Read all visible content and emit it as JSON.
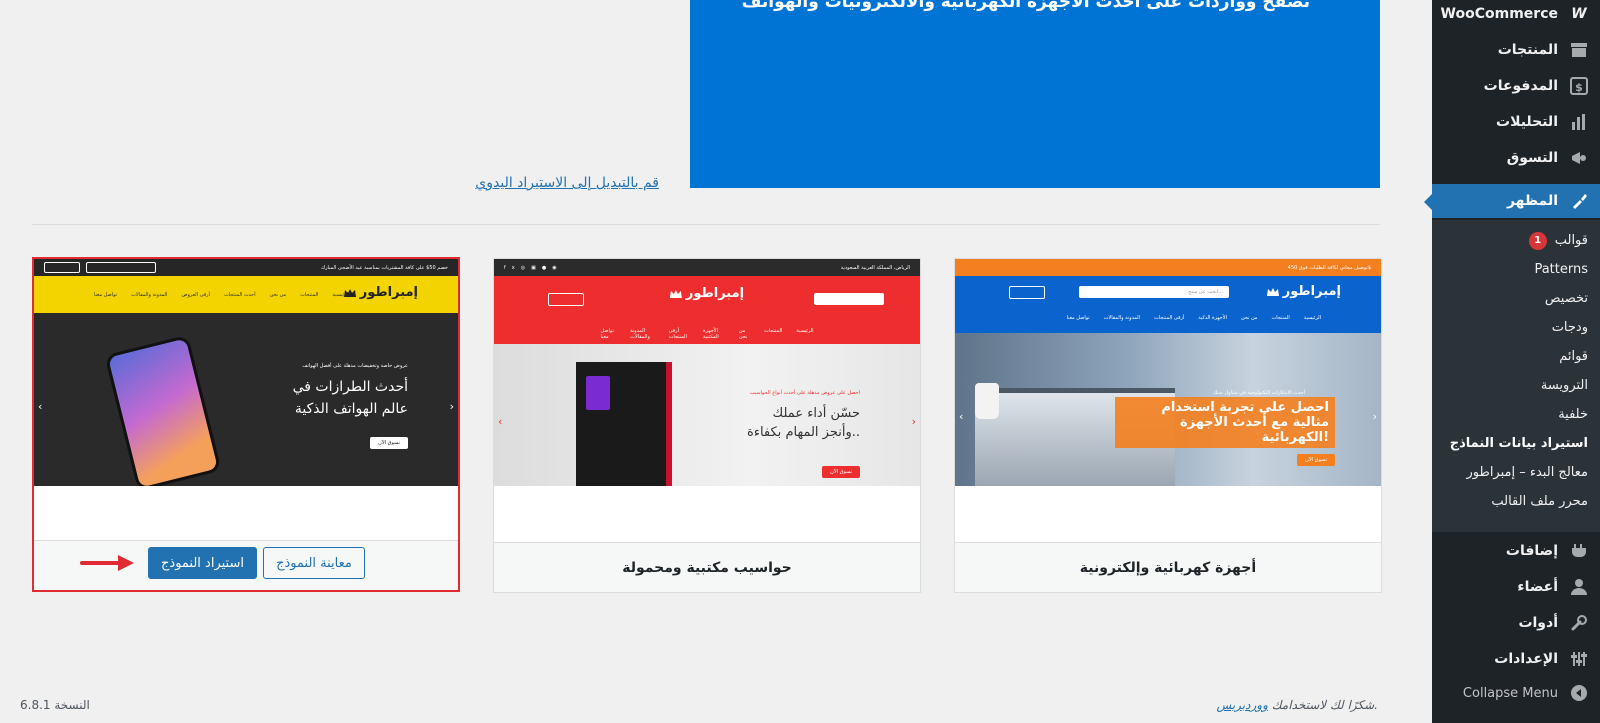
{
  "banner": {
    "text": "تصفح وواردات على أحدث الأجهزة الكهربائية والالكترونيات والهواتف"
  },
  "manual_link": "قم بالتبديل إلى الاستيراد اليدوي",
  "cards": [
    {
      "name": "أجهزة كهربائية وإلكترونية",
      "top_text": "توصيل مجاني لكافة الطلبات فوق 450$",
      "logo": "إمبراطور",
      "search_placeholder": "ابحث عن منتج...",
      "nav": [
        "الرئيسية",
        "المنتجات",
        "من نحن",
        "الأجهزة الذكية",
        "أرقى المنتجات",
        "المدونة والمقالات",
        "تواصل معنا"
      ],
      "eyebrow": "أحدث الابتكارات التكنولوجية في متناول يديك",
      "headline1": "احصل على تجربة استخدام",
      "headline2": "مثالية مع أحدث الأجهزة الكهربائية!",
      "cta": "تسوق الآن"
    },
    {
      "name": "حواسيب مكتبية ومحمولة",
      "top_text": "الرياض، المملكة العربية السعودية",
      "logo": "إمبراطور",
      "nav": [
        "الرئيسية",
        "المنتجات",
        "من نحن",
        "الأجهزة المكتبية",
        "أرقى المنتجات",
        "المدونة والمقالات",
        "تواصل معنا"
      ],
      "eyebrow": "احصل على عروض مذهلة على أحدث أنواع الحواسيب",
      "headline1": "حسّن أداء عملك",
      "headline2": "وأنجز المهام بكفاءة..",
      "cta": "تسوق الآن"
    },
    {
      "name": "",
      "top_text": "خصم 50$ على كافة المشتريات بمناسبة عيد الأضحى المبارك",
      "logo": "إمبراطور",
      "nav": [
        "الرئيسية",
        "المنتجات",
        "من نحن",
        "أحدث المنتجات",
        "أرقى العروض",
        "المدونة والمقالات",
        "تواصل معنا"
      ],
      "eyebrow": "عروض خاصة وتخفيضات مذهلة على أفضل الهواتف",
      "headline1": "أحدث الطرازات في",
      "headline2": "عالم الهواتف الذكية",
      "cta": "تسوق الآن",
      "import_button": "استيراد النموذج",
      "preview_button": "معاينة النموذج"
    }
  ],
  "sidebar": {
    "items": [
      {
        "label": "WooCommerce",
        "icon": "woo-icon"
      },
      {
        "label": "المنتجات",
        "icon": "archive-icon"
      },
      {
        "label": "المدفوعات",
        "icon": "payments-icon"
      },
      {
        "label": "التحليلات",
        "icon": "bar-chart-icon"
      },
      {
        "label": "التسوق",
        "icon": "megaphone-icon"
      },
      {
        "label": "المظهر",
        "icon": "brush-icon"
      },
      {
        "label": "إضافات",
        "icon": "plugin-icon"
      },
      {
        "label": "أعضاء",
        "icon": "users-icon"
      },
      {
        "label": "أدوات",
        "icon": "wrench-icon"
      },
      {
        "label": "الإعدادات",
        "icon": "settings-icon"
      },
      {
        "label": "Collapse Menu",
        "icon": "collapse-icon"
      }
    ],
    "submenu": [
      {
        "label": "قوالب",
        "badge": "1"
      },
      {
        "label": "Patterns"
      },
      {
        "label": "تخصيص"
      },
      {
        "label": "ودجات"
      },
      {
        "label": "قوائم"
      },
      {
        "label": "الترويسة"
      },
      {
        "label": "خلفية"
      },
      {
        "label": "استيراد بيانات النماذج"
      },
      {
        "label": "معالج البدء – إمبراطور"
      },
      {
        "label": "محرر ملف القالب"
      }
    ]
  },
  "footer": {
    "thanks_prefix": "شكرًا لك لاستخدامك",
    "thanks_link": "ووردبريس",
    "thanks_suffix": ".",
    "version": "النسخة 6.8.1"
  },
  "colors": {
    "accent": "#2271b1",
    "sidebar": "#1d2327",
    "selected_border": "#e02b33",
    "badge": "#d63638"
  }
}
